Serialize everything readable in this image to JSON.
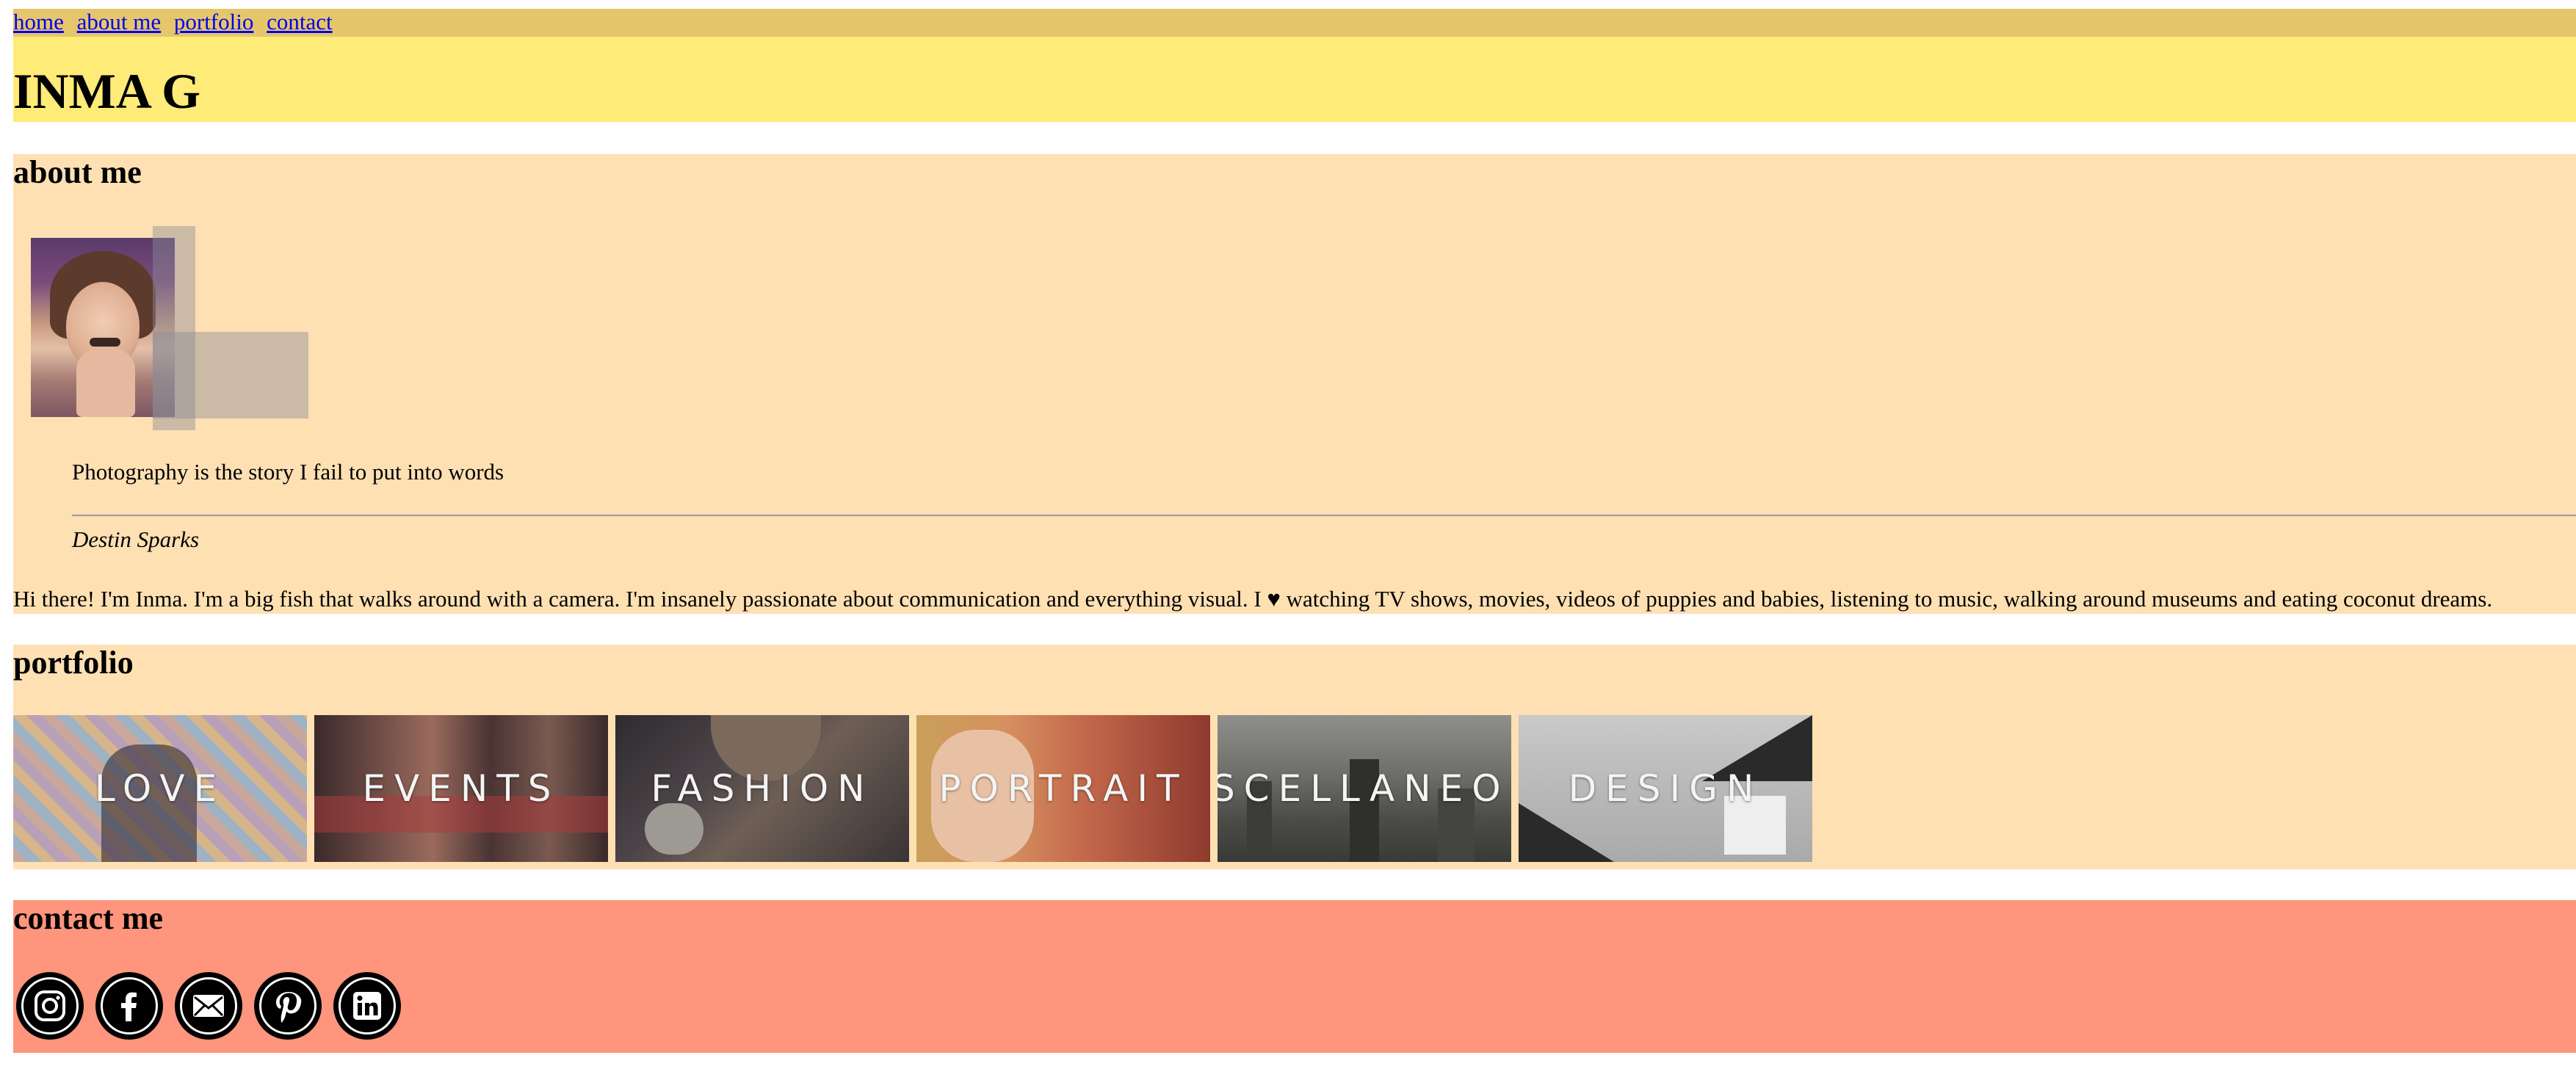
{
  "nav": {
    "links": [
      "home",
      "about me",
      "portfolio",
      "contact"
    ]
  },
  "header": {
    "title": "INMA G"
  },
  "about": {
    "heading": "about me",
    "quote": "Photography is the story I fail to put into words",
    "quote_author": "Destin Sparks",
    "bio": "Hi there! I'm Inma. I'm a big fish that walks around with a camera. I'm insanely passionate about communication and everything visual. I ♥ watching TV shows, movies, videos of puppies and babies, listening to music, walking around museums and eating coconut dreams."
  },
  "portfolio": {
    "heading": "portfolio",
    "tiles": [
      "LOVE",
      "EVENTS",
      "FASHION",
      "PORTRAIT",
      "MISCELLANEOUS",
      "DESIGN"
    ]
  },
  "contact": {
    "heading": "contact me",
    "icons": [
      "instagram-icon",
      "facebook-icon",
      "email-icon",
      "pinterest-icon",
      "linkedin-icon"
    ]
  },
  "colors": {
    "nav_bg": "#e5c66a",
    "header_bg": "#ffeb77",
    "section_bg": "#ffe0b3",
    "contact_bg": "#ff957d"
  }
}
